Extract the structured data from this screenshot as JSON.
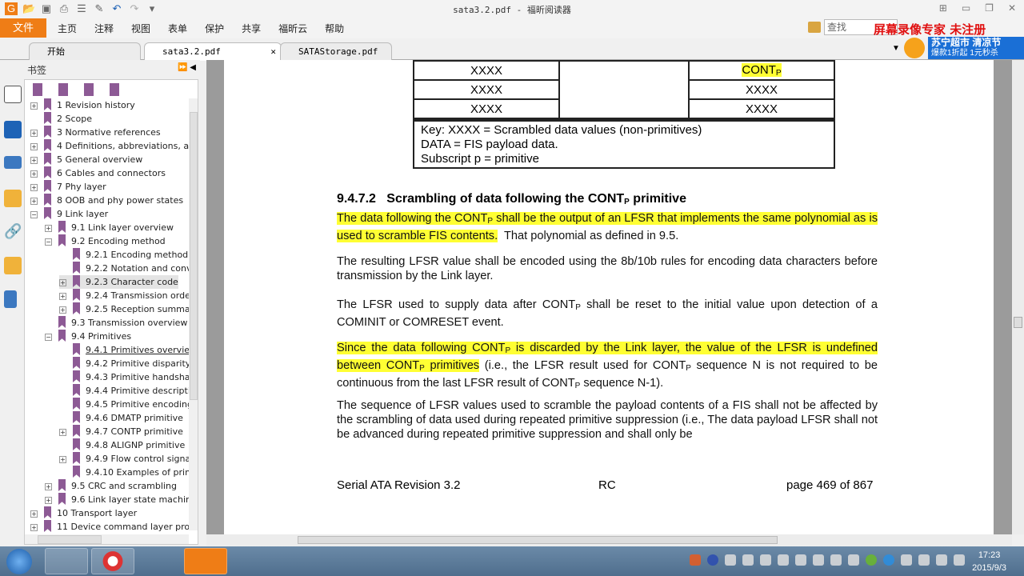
{
  "window": {
    "title": "sata3.2.pdf - 福昕阅读器"
  },
  "menu": {
    "file": "文件",
    "items": [
      "主页",
      "注释",
      "视图",
      "表单",
      "保护",
      "共享",
      "福昕云",
      "帮助"
    ]
  },
  "search": {
    "placeholder": "查找"
  },
  "watermark": "屏幕录像专家 未注册",
  "ad": {
    "line1": "苏宁超市 清凉节",
    "line2": "爆款1折起 1元秒杀"
  },
  "tabs": [
    {
      "label": "开始"
    },
    {
      "label": "sata3.2.pdf",
      "active": true
    },
    {
      "label": "SATAStorage.pdf"
    }
  ],
  "sidebar": {
    "title": "书签",
    "bookmarks": [
      {
        "label": "1 Revision history",
        "level": 0,
        "exp": "+"
      },
      {
        "label": "2 Scope",
        "level": 0,
        "exp": ""
      },
      {
        "label": "3 Normative references",
        "level": 0,
        "exp": "+"
      },
      {
        "label": "4 Definitions, abbreviations, and",
        "level": 0,
        "exp": "+"
      },
      {
        "label": "5 General overview",
        "level": 0,
        "exp": "+"
      },
      {
        "label": "6 Cables and connectors",
        "level": 0,
        "exp": "+"
      },
      {
        "label": "7 Phy layer",
        "level": 0,
        "exp": "+"
      },
      {
        "label": "8 OOB and phy power states",
        "level": 0,
        "exp": "+"
      },
      {
        "label": "9 Link layer",
        "level": 0,
        "exp": "-"
      },
      {
        "label": "9.1 Link layer overview",
        "level": 1,
        "exp": "+"
      },
      {
        "label": "9.2 Encoding method",
        "level": 1,
        "exp": "-"
      },
      {
        "label": "9.2.1 Encoding method c",
        "level": 2,
        "exp": ""
      },
      {
        "label": "9.2.2 Notation and conv",
        "level": 2,
        "exp": ""
      },
      {
        "label": "9.2.3 Character code",
        "level": 2,
        "exp": "+",
        "selected": true
      },
      {
        "label": "9.2.4 Transmission order",
        "level": 2,
        "exp": "+"
      },
      {
        "label": "9.2.5 Reception summary",
        "level": 2,
        "exp": "+"
      },
      {
        "label": "9.3 Transmission overview",
        "level": 1,
        "exp": ""
      },
      {
        "label": "9.4 Primitives",
        "level": 1,
        "exp": "-"
      },
      {
        "label": "9.4.1 Primitives overview",
        "level": 2,
        "exp": "",
        "current": true
      },
      {
        "label": "9.4.2 Primitive disparity",
        "level": 2,
        "exp": ""
      },
      {
        "label": "9.4.3 Primitive handshak",
        "level": 2,
        "exp": ""
      },
      {
        "label": "9.4.4 Primitive descriptio",
        "level": 2,
        "exp": ""
      },
      {
        "label": "9.4.5 Primitive encoding",
        "level": 2,
        "exp": ""
      },
      {
        "label": "9.4.6 DMATP primitive",
        "level": 2,
        "exp": ""
      },
      {
        "label": "9.4.7 CONTP primitive",
        "level": 2,
        "exp": "+"
      },
      {
        "label": "9.4.8 ALIGNP primitive",
        "level": 2,
        "exp": ""
      },
      {
        "label": "9.4.9 Flow control signal",
        "level": 2,
        "exp": "+"
      },
      {
        "label": "9.4.10 Examples of primi",
        "level": 2,
        "exp": ""
      },
      {
        "label": "9.5 CRC and scrambling",
        "level": 1,
        "exp": "+"
      },
      {
        "label": "9.6 Link layer state machine",
        "level": 1,
        "exp": "+"
      },
      {
        "label": "10 Transport layer",
        "level": 0,
        "exp": "+"
      },
      {
        "label": "11 Device command layer proto",
        "level": 0,
        "exp": "+"
      }
    ]
  },
  "document": {
    "table": {
      "rows": [
        [
          "XXXX",
          "",
          "CONT",
          "P"
        ],
        [
          "XXXX",
          "",
          "XXXX",
          ""
        ],
        [
          "XXXX",
          "",
          "XXXX",
          ""
        ]
      ],
      "key": [
        "Key: XXXX = Scrambled data values (non-primitives)",
        "DATA = FIS payload data.",
        "Subscript p = primitive"
      ]
    },
    "heading": {
      "number": "9.4.7.2",
      "text": "Scrambling of data following the CONT",
      "sub": "P",
      "after": " primitive"
    },
    "p1": {
      "hl": "The data following the CONT",
      "sub": "P",
      "hl2": " shall be the output of an LFSR that implements the same polynomial as is used to scramble FIS contents.",
      "rest": "  That polynomial as defined in 9.5."
    },
    "p2": "The resulting LFSR value shall be encoded using the 8b/10b rules for encoding data characters before transmission by the Link layer.",
    "p3": {
      "a": "The LFSR used to supply data after CONT",
      "sub": "P",
      "b": " shall be reset to the initial value upon detection of a COMINIT or COMRESET event."
    },
    "p4": {
      "hl1": "Since the data following CONT",
      "sub": "P",
      "hl2": " is discarded by the Link layer, the value of the LFSR is undefined between CONT",
      "hl3": " primitives",
      "b": " (i.e., the LFSR result used for CONT",
      "c": " sequence N is not required to be continuous from the last LFSR result of CONT",
      "d": " sequence N-1)."
    },
    "p5": "The sequence of LFSR values used to scramble the payload contents of a FIS shall not be affected by the scrambling of data used during repeated primitive suppression (i.e., The data payload LFSR shall not be advanced during repeated primitive suppression and shall only be",
    "footer": {
      "left": "Serial ATA Revision 3.2",
      "center": "RC",
      "right": "page 469 of 867"
    }
  },
  "taskbar": {
    "time": "17:23",
    "date": "2015/9/3"
  },
  "colors": {
    "accent": "#ef7d16",
    "highlight": "#ffff33",
    "bookmark": "#8d5a95"
  }
}
